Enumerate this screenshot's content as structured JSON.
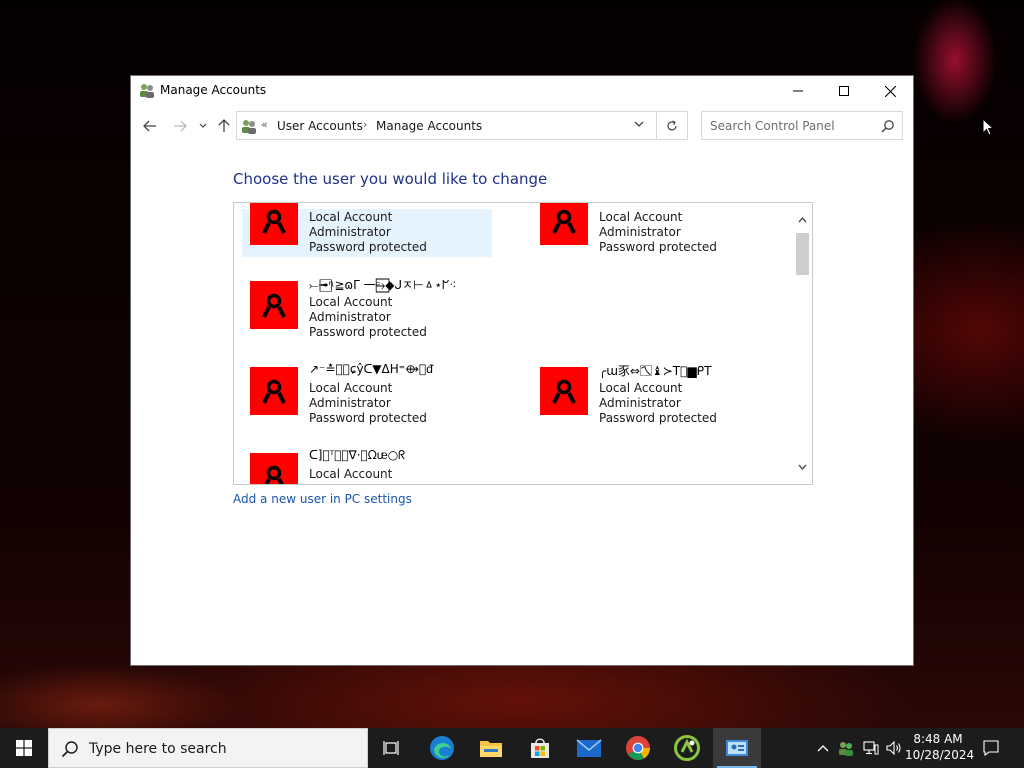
{
  "window": {
    "title": "Manage Accounts",
    "controls": {
      "minimize": "minimize",
      "maximize": "maximize",
      "close": "close"
    }
  },
  "address": {
    "crumb_sep": "«",
    "crumbs": [
      "User Accounts",
      "Manage Accounts"
    ],
    "crumb_arrow": "›",
    "search_placeholder": "Search Control Panel"
  },
  "main": {
    "heading": "Choose the user you would like to change",
    "accounts": [
      {
        "name": "",
        "type": "Local Account",
        "role": "Administrator",
        "status": "Password protected",
        "selected": true
      },
      {
        "name": "",
        "type": "Local Account",
        "role": "Administrator",
        "status": "Password protected",
        "selected": false
      },
      {
        "name": "⤚➟⃞⃞ᶯ≧ɷᒥ ⼀⥱⃞◆ᒍㅈ⊢ㅿ⋆ᖸ⁖",
        "type": "Local Account",
        "role": "Administrator",
        "status": "Password protected",
        "selected": false
      },
      {
        "name": "↗⁻≛⃞⃞ɕŷᑕ▼ᐃH⁼⟴⃞ᵭ",
        "type": "Local Account",
        "role": "Administrator",
        "status": "Password protected",
        "selected": false
      },
      {
        "name": "╭ɯ豕⇔ㄟ⃞♝≻T⃞▆ᑭT",
        "type": "Local Account",
        "role": "Administrator",
        "status": "Password protected",
        "selected": false
      },
      {
        "name": "ᑕ]⃞ᵀ⃞⥼∇⋅⃞ᘯᵫ○ᖇ",
        "type": "Local Account",
        "role": "",
        "status": "",
        "selected": false
      }
    ],
    "add_user_link": "Add a new user in PC settings"
  },
  "taskbar": {
    "search_placeholder": "Type here to search",
    "apps": [
      "task-view",
      "edge",
      "file-explorer",
      "store",
      "mail",
      "chrome",
      "utility",
      "control-panel"
    ],
    "clock_time": "8:48 AM",
    "clock_date": "10/28/2024"
  },
  "colors": {
    "avatar_bg": "#ff0000",
    "heading": "#1e3287",
    "link": "#1a55a8",
    "taskbar": "#1c1c1c"
  }
}
